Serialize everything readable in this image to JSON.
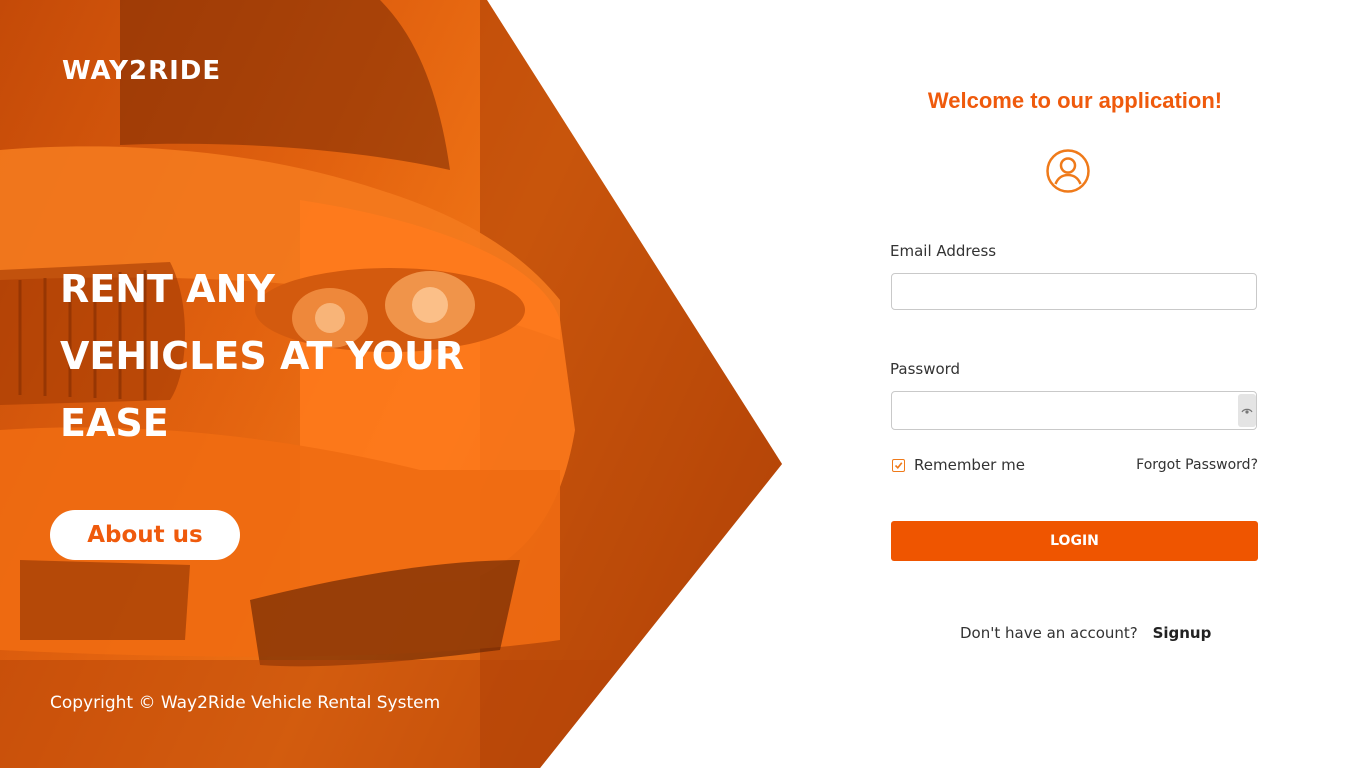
{
  "brand": {
    "name": "WAY2RIDE"
  },
  "hero": {
    "headline": "RENT ANY VEHICLES AT YOUR EASE",
    "about_label": "About us",
    "copyright": "Copyright © Way2Ride Vehicle Rental System",
    "image": "orange-sports-car-photo"
  },
  "form": {
    "welcome": "Welcome to our application!",
    "icon": "user-circle-icon",
    "email_label": "Email Address",
    "email_value": "",
    "password_label": "Password",
    "password_value": "",
    "remember_label": "Remember me",
    "remember_checked": true,
    "forgot_label": "Forgot Password?",
    "login_label": "LOGIN",
    "no_account_text": "Don't have an account?",
    "signup_label": "Signup"
  },
  "colors": {
    "accent": "#ef5500",
    "hero_base": "#e2620f",
    "text": "#333333"
  }
}
